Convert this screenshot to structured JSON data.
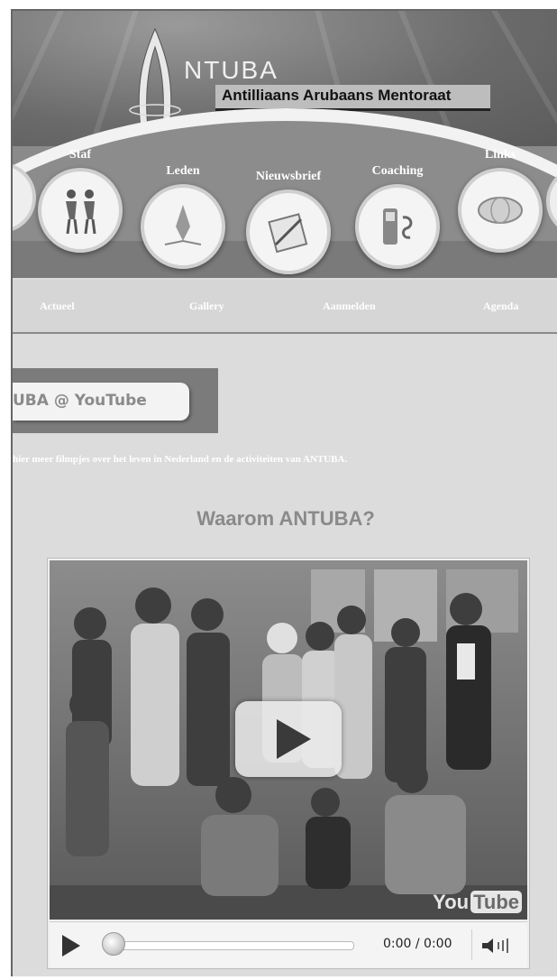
{
  "header": {
    "logo_title": "NTUBA",
    "logo_subtitle": "Antilliaans Arubaans Mentoraat"
  },
  "nav": {
    "items": [
      {
        "label": "Staf",
        "icon": "staff-people-icon"
      },
      {
        "label": "Leden",
        "icon": "members-icon"
      },
      {
        "label": "Nieuwsbrief",
        "icon": "newsletter-icon"
      },
      {
        "label": "Coaching",
        "icon": "coaching-phone-icon"
      },
      {
        "label": "Links",
        "icon": "links-icon"
      }
    ]
  },
  "subnav": {
    "items": [
      "Actueel",
      "Gallery",
      "Aanmelden",
      "Agenda"
    ]
  },
  "youtube_tab": {
    "label": "UBA @ YouTube"
  },
  "intro_text": "hier meer filmpjes over het leven in Nederland en de activiteiten van ANTUBA.",
  "video": {
    "heading": "Waarom ANTUBA?",
    "logo_you": "You",
    "logo_tube": "Tube",
    "time": "0:00 / 0:00",
    "progress": 0
  }
}
